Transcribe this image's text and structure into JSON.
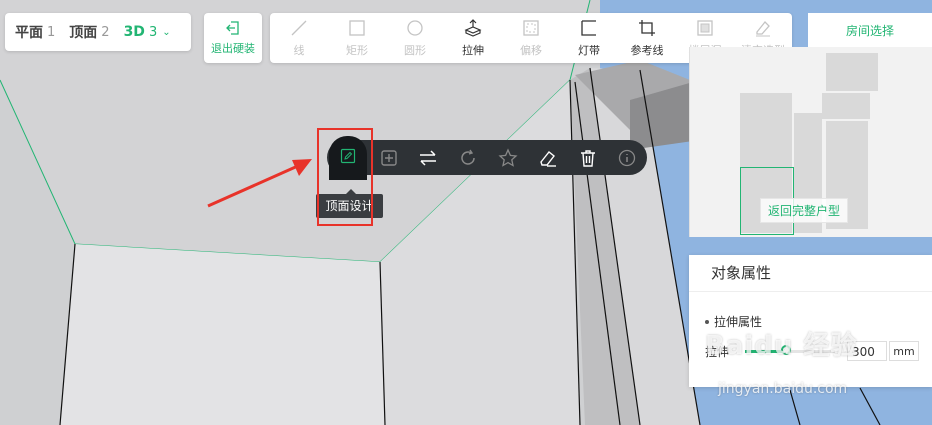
{
  "view_switch": {
    "items": [
      {
        "label": "平面",
        "num": "1"
      },
      {
        "label": "顶面",
        "num": "2"
      },
      {
        "label": "3D",
        "num": "3"
      }
    ]
  },
  "exit_button": {
    "label": "退出硬装"
  },
  "toolbar": {
    "tools": [
      {
        "label": "线",
        "icon": "line-icon",
        "enabled": false
      },
      {
        "label": "矩形",
        "icon": "rectangle-icon",
        "enabled": false
      },
      {
        "label": "圆形",
        "icon": "circle-icon",
        "enabled": false
      },
      {
        "label": "拉伸",
        "icon": "extrude-icon",
        "enabled": true
      },
      {
        "label": "偏移",
        "icon": "offset-icon",
        "enabled": false
      },
      {
        "label": "灯带",
        "icon": "light-strip-icon",
        "enabled": true
      },
      {
        "label": "参考线",
        "icon": "reference-line-icon",
        "enabled": true
      },
      {
        "label": "楼层洞",
        "icon": "floor-hole-icon",
        "enabled": false
      },
      {
        "label": "清空造型",
        "icon": "clear-shape-icon",
        "enabled": false
      }
    ]
  },
  "right_panel": {
    "room_select_label": "房间选择",
    "return_button_label": "返回完整户型"
  },
  "properties": {
    "title": "对象属性",
    "section_label": "拉伸属性",
    "stretch_label": "拉伸",
    "stretch_value": "300",
    "unit": "mm",
    "slider_fraction": 0.45
  },
  "context_toolbar": {
    "icons": [
      "ceiling-edit-icon",
      "add-icon",
      "swap-icon",
      "rotate-icon",
      "star-icon",
      "eraser-icon",
      "trash-icon",
      "info-icon"
    ],
    "tooltip": "顶面设计"
  },
  "watermark": {
    "text": "Baidu 经验",
    "url": "jingyan.baidu.com"
  },
  "colors": {
    "accent": "#22b573",
    "toolbar_dark": "#2e3236",
    "annotation": "#e8332a"
  }
}
